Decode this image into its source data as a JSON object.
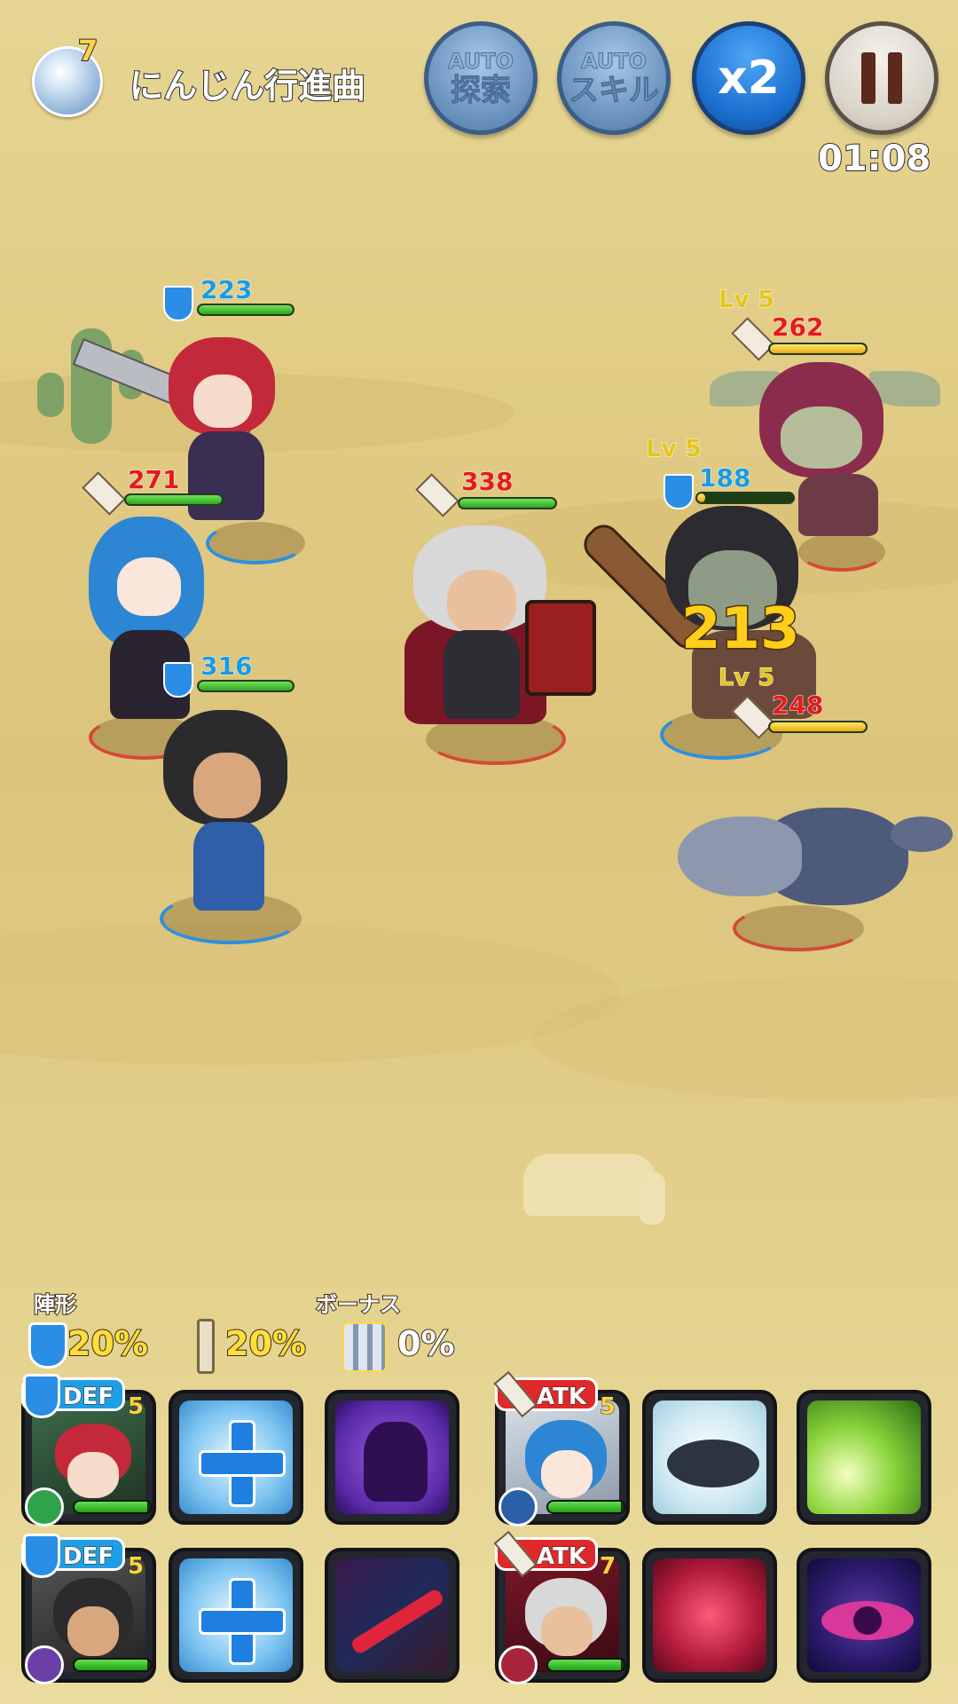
{
  "header": {
    "orb_badge": "7",
    "quest_title": "にんじん行進曲",
    "auto_explore": {
      "line1": "AUTO",
      "line2": "探索"
    },
    "auto_skill": {
      "line1": "AUTO",
      "line2": "スキル"
    },
    "speed_label": "x2",
    "timer": "01:08"
  },
  "allies": [
    {
      "stat": "223",
      "type": "def",
      "hp": 1.0
    },
    {
      "stat": "271",
      "type": "atk",
      "hp": 1.0
    },
    {
      "stat": "316",
      "type": "def",
      "hp": 1.0
    },
    {
      "stat": "338",
      "type": "atk",
      "hp": 1.0
    }
  ],
  "enemies": [
    {
      "level": "Lv 5",
      "stat": "262",
      "type": "atk",
      "hp": 1.0
    },
    {
      "level": "Lv 5",
      "stat": "188",
      "type": "def",
      "hp": 0.08
    },
    {
      "level": "Lv 5",
      "stat": "248",
      "type": "atk",
      "hp": 1.0
    }
  ],
  "damage_popup": "213",
  "bonus": {
    "formation_label": "陣形",
    "bonus_label": "ボーナス",
    "def_pct": "20%",
    "atk_pct": "20%",
    "bonus_pct": "0%"
  },
  "party": [
    {
      "role": "DEF",
      "level": "5",
      "hp": 0.95
    },
    {
      "role": "ATK",
      "level": "5",
      "hp": 0.95
    },
    {
      "role": "DEF",
      "level": "5",
      "hp": 0.95
    },
    {
      "role": "ATK",
      "level": "7",
      "hp": 0.95
    }
  ],
  "colors": {
    "def": "#1f9ee6",
    "atk": "#e0282a",
    "hp": "#2fa61c",
    "enemy_hp": "#e7ad12",
    "damage": "#ffce19"
  }
}
